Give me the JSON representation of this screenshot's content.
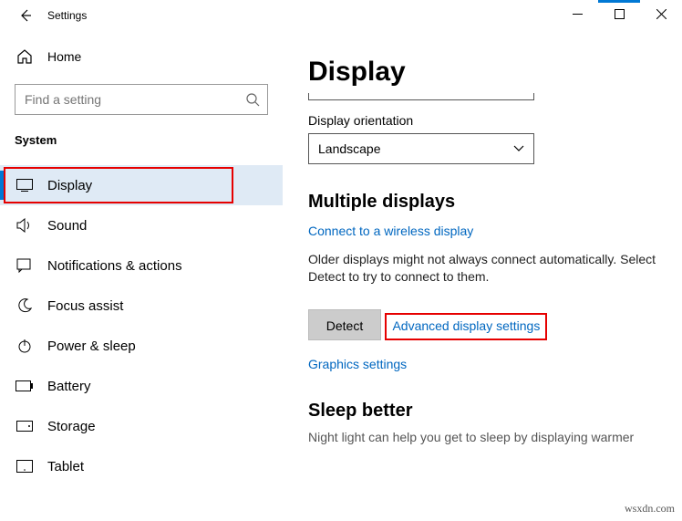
{
  "window": {
    "title": "Settings"
  },
  "sidebar": {
    "home_label": "Home",
    "search_placeholder": "Find a setting",
    "section_label": "System",
    "items": [
      {
        "label": "Display",
        "icon": "monitor-icon",
        "selected": true
      },
      {
        "label": "Sound",
        "icon": "sound-icon"
      },
      {
        "label": "Notifications & actions",
        "icon": "notifications-icon"
      },
      {
        "label": "Focus assist",
        "icon": "moon-icon"
      },
      {
        "label": "Power & sleep",
        "icon": "power-icon"
      },
      {
        "label": "Battery",
        "icon": "battery-icon"
      },
      {
        "label": "Storage",
        "icon": "storage-icon"
      },
      {
        "label": "Tablet",
        "icon": "tablet-icon"
      }
    ]
  },
  "main": {
    "page_title": "Display",
    "orientation": {
      "label": "Display orientation",
      "value": "Landscape"
    },
    "multi": {
      "heading": "Multiple displays",
      "wireless_link": "Connect to a wireless display",
      "detect_hint": "Older displays might not always connect automatically. Select Detect to try to connect to them.",
      "detect_button": "Detect",
      "advanced_link": "Advanced display settings",
      "graphics_link": "Graphics settings"
    },
    "sleep": {
      "heading": "Sleep better",
      "body": "Night light can help you get to sleep by displaying warmer"
    }
  },
  "watermark": "wsxdn.com"
}
